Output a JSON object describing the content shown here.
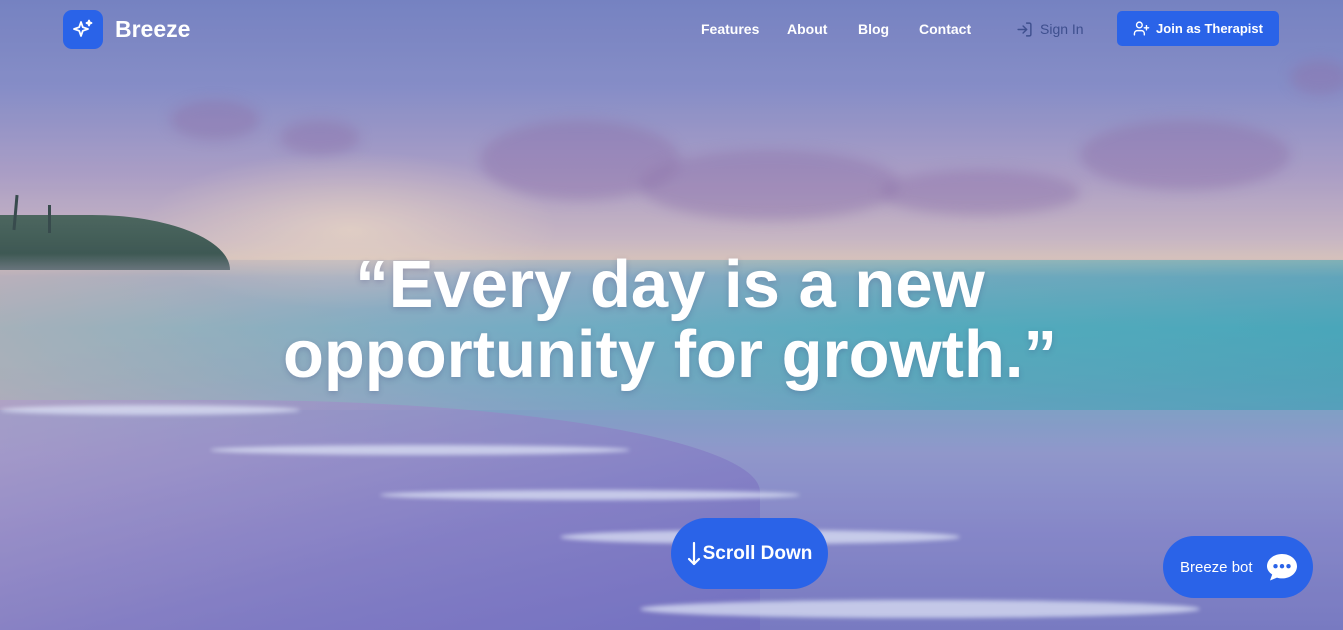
{
  "brand": {
    "name": "Breeze",
    "logo_icon": "sparkles-icon"
  },
  "nav": {
    "links": [
      "Features",
      "About",
      "Blog",
      "Contact"
    ],
    "sign_in": "Sign In",
    "sign_in_icon": "login-icon",
    "join": "Join as Therapist",
    "join_icon": "user-plus-icon"
  },
  "hero": {
    "quote_line1": "“Every day is a new",
    "quote_line2": "opportunity for growth.”",
    "scroll_label": "Scroll Down",
    "scroll_icon": "arrow-down-icon"
  },
  "bot": {
    "label": "Breeze bot",
    "icon": "chat-bubble-icon"
  },
  "colors": {
    "accent": "#2a63e8",
    "sign_in_text": "#3e4f8e",
    "text_light": "#ffffff"
  }
}
